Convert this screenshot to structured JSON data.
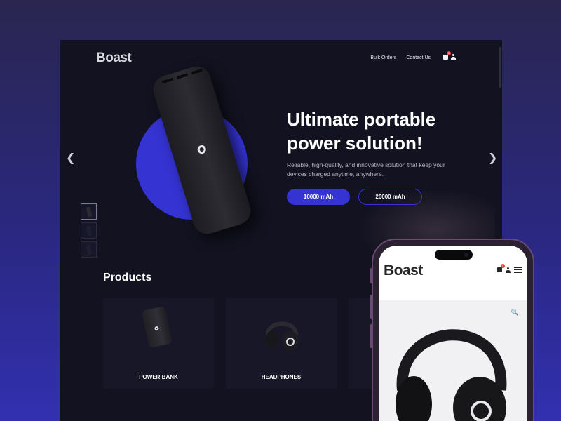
{
  "desktop": {
    "logo": "Boast",
    "nav": {
      "bulk_orders": "Bulk Orders",
      "contact_us": "Contact Us"
    },
    "cart_count": "0",
    "hero": {
      "title": "Ultimate portable power solution!",
      "description": "Reliable, high-quality, and innovative solution that keep your devices charged anytime, anywhere.",
      "buttons": {
        "primary": "10000 mAh",
        "secondary": "20000 mAh"
      }
    },
    "products": {
      "title": "Products",
      "items": [
        {
          "label": "POWER BANK"
        },
        {
          "label": "HEADPHONES"
        }
      ]
    }
  },
  "phone": {
    "logo": "Boast",
    "cart_count": "4"
  },
  "colors": {
    "accent": "#3533d2",
    "background": "#121220",
    "badge": "#e53f3f"
  }
}
